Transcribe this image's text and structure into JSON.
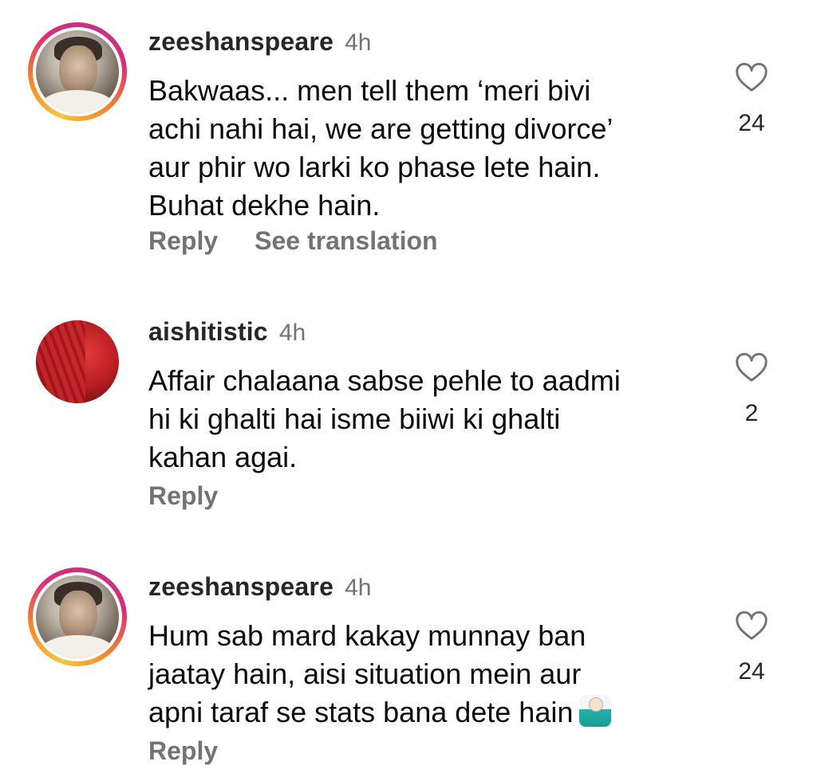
{
  "comments": [
    {
      "username": "zeeshanspeare",
      "time": "4h",
      "text": "Bakwaas... men tell them ‘meri bivi\nachi nahi hai, we are getting divorce’\naur phir wo larki ko phase lete hain.\nBuhat dekhe hain.",
      "likes": "24",
      "reply_label": "Reply",
      "translate_label": "See translation",
      "avatar_icon": "profile-photo-ring",
      "has_story_ring": true
    },
    {
      "username": "aishitistic",
      "time": "4h",
      "text": "Affair chalaana sabse pehle to aadmi\nhi ki ghalti hai isme biiwi ki ghalti\nkahan agai.",
      "likes": "2",
      "reply_label": "Reply",
      "avatar_icon": "profile-photo",
      "has_story_ring": false
    },
    {
      "username": "zeeshanspeare",
      "time": "4h",
      "text": "Hum sab mard kakay munnay ban\njaatay hain, aisi situation mein aur\napni taraf se stats bana dete hain",
      "emoji": "person-shrugging-emoji",
      "likes": "24",
      "reply_label": "Reply",
      "avatar_icon": "profile-photo-ring",
      "has_story_ring": true
    }
  ],
  "colors": {
    "username": "#262626",
    "meta": "#737373",
    "text": "#0a0a0a",
    "background": "#ffffff"
  }
}
